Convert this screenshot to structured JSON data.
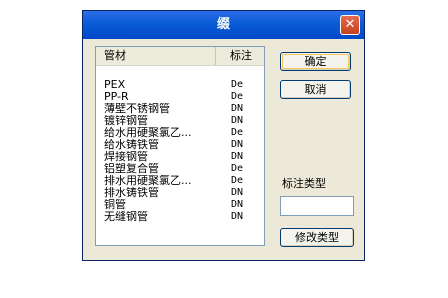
{
  "window": {
    "title": "缀",
    "close_glyph": "✕"
  },
  "list": {
    "headers": [
      "管材",
      "标注"
    ],
    "rows": [
      {
        "name": "PEX",
        "note": "De"
      },
      {
        "name": "PP-R",
        "note": "De"
      },
      {
        "name": "薄壁不锈钢管",
        "note": "DN"
      },
      {
        "name": "镀锌钢管",
        "note": "DN"
      },
      {
        "name": "给水用硬聚氯乙...",
        "note": "De"
      },
      {
        "name": "给水铸铁管",
        "note": "DN"
      },
      {
        "name": "焊接钢管",
        "note": "DN"
      },
      {
        "name": "铝塑复合管",
        "note": "De"
      },
      {
        "name": "排水用硬聚氯乙...",
        "note": "De"
      },
      {
        "name": "排水铸铁管",
        "note": "DN"
      },
      {
        "name": "铜管",
        "note": "DN"
      },
      {
        "name": "无缝钢管",
        "note": "DN"
      }
    ]
  },
  "buttons": {
    "ok": "确定",
    "cancel": "取消",
    "modify": "修改类型"
  },
  "type_label": "标注类型",
  "type_input": {
    "value": ""
  },
  "colors": {
    "titlebar": "#0a5bd6",
    "dialog_bg": "#ece9d8",
    "close": "#c3421f"
  }
}
